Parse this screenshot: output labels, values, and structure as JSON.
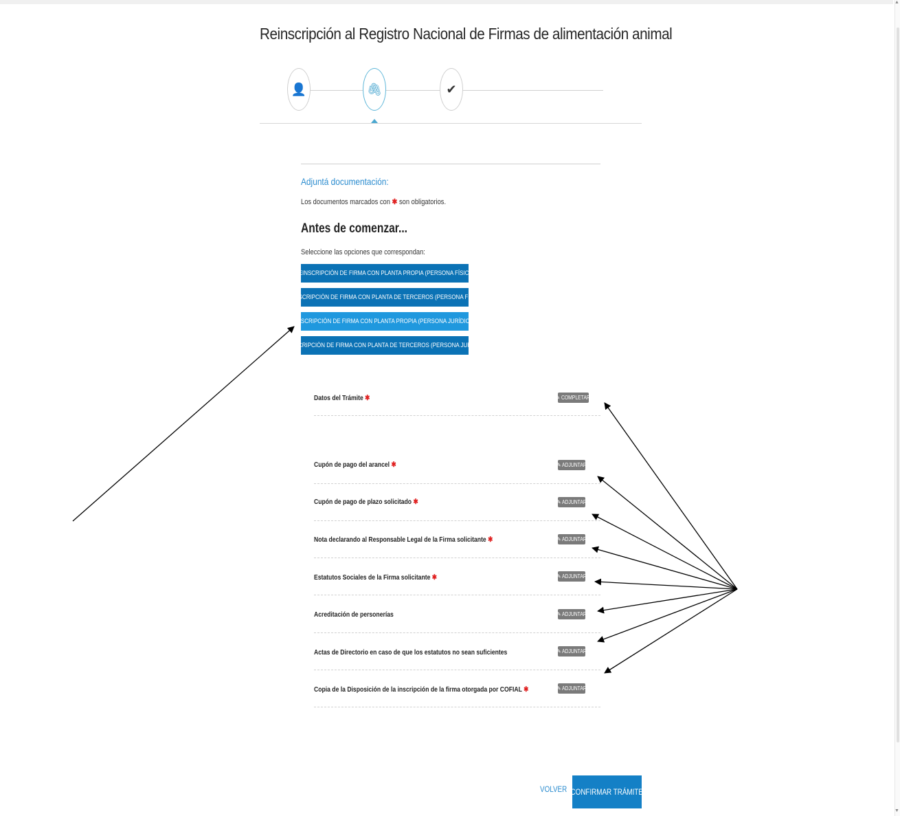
{
  "page": {
    "title": "Reinscripción al Registro Nacional de Firmas de alimentación animal"
  },
  "stepper": {
    "steps": [
      {
        "icon": "user-icon",
        "glyph": "👤",
        "active": false
      },
      {
        "icon": "paperclip-icon",
        "glyph": "🖇",
        "active": true
      },
      {
        "icon": "checkmark-icon",
        "glyph": "✔",
        "active": false
      }
    ]
  },
  "attach": {
    "subtitle": "Adjuntá documentación:",
    "hint_pre": "Los documentos marcados con ",
    "hint_mark": "✱",
    "hint_post": " son obligatorios.",
    "heading": "Antes de comenzar...",
    "select_label": "Seleccione las opciones que correspondan:"
  },
  "options": [
    {
      "label": "REINSCRIPCIÓN DE FIRMA CON PLANTA PROPIA (PERSONA FÍSICA)",
      "selected": false
    },
    {
      "label": "REINSCRIPCIÓN DE FIRMA CON PLANTA DE TERCEROS (PERSONA FÍSICA)",
      "selected": false
    },
    {
      "label": "REINSCRIPCIÓN DE FIRMA CON PLANTA PROPIA (PERSONA JURÍDICA) ☑",
      "selected": true
    },
    {
      "label": "REINSCRIPCIÓN DE FIRMA CON PLANTA DE TERCEROS (PERSONA JURÍDICA)",
      "selected": false
    }
  ],
  "documents": [
    {
      "label": "Datos del Trámite",
      "required": true,
      "action": "✎ COMPLETAR"
    },
    {
      "label": "Cupón de pago del arancel",
      "required": true,
      "action": "✎ ADJUNTAR"
    },
    {
      "label": "Cupón de pago de plazo solicitado",
      "required": true,
      "action": "✎ ADJUNTAR"
    },
    {
      "label": "Nota declarando al Responsable Legal de la Firma solicitante",
      "required": true,
      "action": "✎ ADJUNTAR"
    },
    {
      "label": "Estatutos Sociales de la Firma solicitante",
      "required": true,
      "action": "✎ ADJUNTAR"
    },
    {
      "label": "Acreditación de personerías",
      "required": false,
      "action": "✎ ADJUNTAR"
    },
    {
      "label": "Actas de Directorio en caso de que los estatutos no sean suficientes",
      "required": false,
      "action": "✎ ADJUNTAR"
    },
    {
      "label": "Copia de la Disposición de la inscripción de la firma otorgada por COFIAL",
      "required": true,
      "action": "✎ ADJUNTAR"
    }
  ],
  "required_mark": "✱",
  "footer": {
    "back_label": "VOLVER",
    "confirm_label": "CONFIRMAR TRÁMITE"
  },
  "colors": {
    "accent": "#1480c6",
    "option": "#0b72b5",
    "option_selected": "#1f98de",
    "required": "#e02020"
  }
}
